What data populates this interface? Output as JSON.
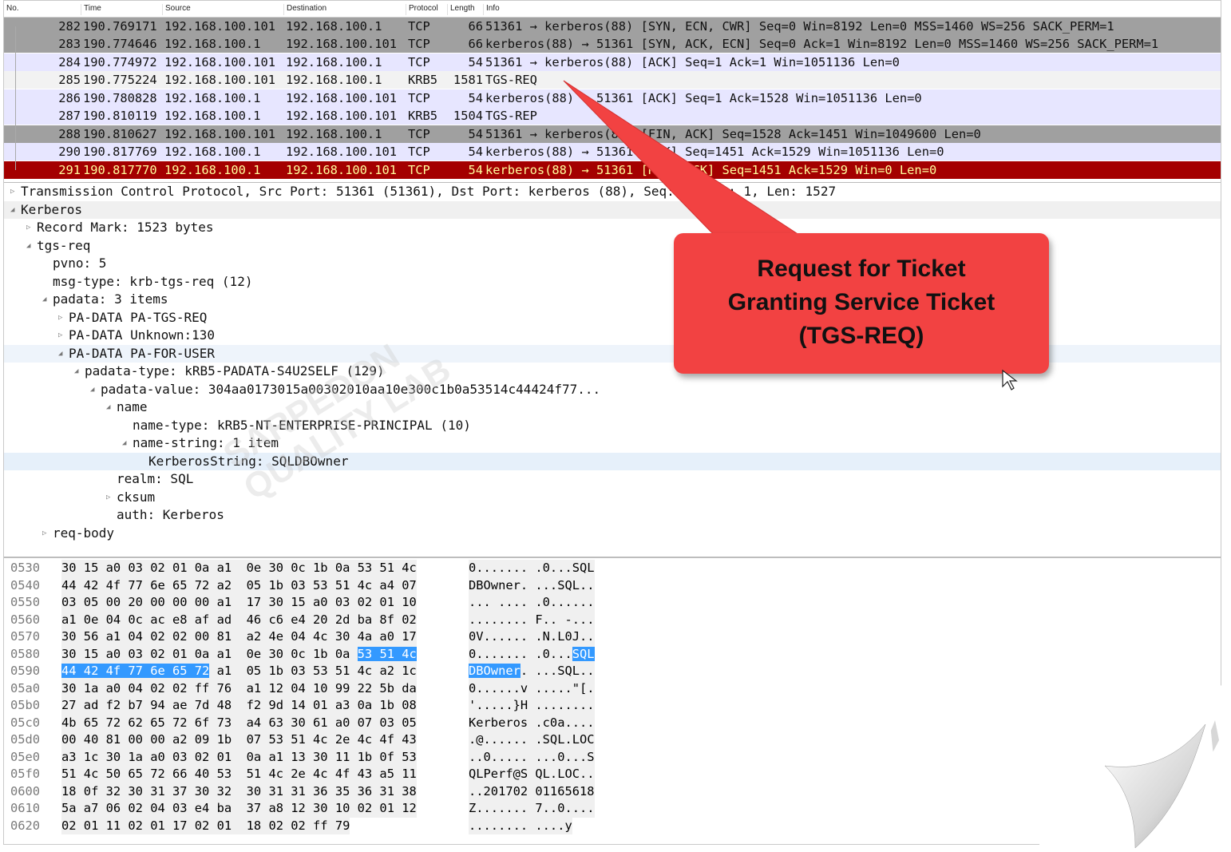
{
  "columns": {
    "no": "No.",
    "time": "Time",
    "source": "Source",
    "destination": "Destination",
    "protocol": "Protocol",
    "length": "Length",
    "info": "Info"
  },
  "packets": [
    {
      "no": "282",
      "time": "190.769171",
      "src": "192.168.100.101",
      "dst": "192.168.100.1",
      "proto": "TCP",
      "len": "66",
      "info": "51361 → kerberos(88) [SYN, ECN, CWR] Seq=0 Win=8192 Len=0 MSS=1460 WS=256 SACK_PERM=1",
      "bg": "#a0a0a0",
      "fg": "#111111"
    },
    {
      "no": "283",
      "time": "190.774646",
      "src": "192.168.100.1",
      "dst": "192.168.100.101",
      "proto": "TCP",
      "len": "66",
      "info": "kerberos(88) → 51361 [SYN, ACK, ECN] Seq=0 Ack=1 Win=8192 Len=0 MSS=1460 WS=256 SACK_PERM=1",
      "bg": "#a0a0a0",
      "fg": "#111111"
    },
    {
      "no": "284",
      "time": "190.774972",
      "src": "192.168.100.101",
      "dst": "192.168.100.1",
      "proto": "TCP",
      "len": "54",
      "info": "51361 → kerberos(88) [ACK] Seq=1 Ack=1 Win=1051136 Len=0",
      "bg": "#e7e6ff",
      "fg": "#111111"
    },
    {
      "no": "285",
      "time": "190.775224",
      "src": "192.168.100.101",
      "dst": "192.168.100.1",
      "proto": "KRB5",
      "len": "1581",
      "info": "TGS-REQ",
      "bg": "#f2f2f2",
      "fg": "#111111"
    },
    {
      "no": "286",
      "time": "190.780828",
      "src": "192.168.100.1",
      "dst": "192.168.100.101",
      "proto": "TCP",
      "len": "54",
      "info": "kerberos(88) → 51361 [ACK] Seq=1 Ack=1528 Win=1051136 Len=0",
      "bg": "#e7e6ff",
      "fg": "#111111"
    },
    {
      "no": "287",
      "time": "190.810119",
      "src": "192.168.100.1",
      "dst": "192.168.100.101",
      "proto": "KRB5",
      "len": "1504",
      "info": "TGS-REP",
      "bg": "#e7e6ff",
      "fg": "#111111"
    },
    {
      "no": "288",
      "time": "190.810627",
      "src": "192.168.100.101",
      "dst": "192.168.100.1",
      "proto": "TCP",
      "len": "54",
      "info": "51361 → kerberos(88) [FIN, ACK] Seq=1528 Ack=1451 Win=1049600 Len=0",
      "bg": "#a0a0a0",
      "fg": "#111111"
    },
    {
      "no": "290",
      "time": "190.817769",
      "src": "192.168.100.1",
      "dst": "192.168.100.101",
      "proto": "TCP",
      "len": "54",
      "info": "kerberos(88) → 51361 [ACK] Seq=1451 Ack=1529 Win=1051136 Len=0",
      "bg": "#e7e6ff",
      "fg": "#111111"
    },
    {
      "no": "291",
      "time": "190.817770",
      "src": "192.168.100.1",
      "dst": "192.168.100.101",
      "proto": "TCP",
      "len": "54",
      "info": "kerberos(88) → 51361 [RST, ACK] Seq=1451 Ack=1529 Win=0 Len=0",
      "bg": "#a40000",
      "fg": "#fffc9c"
    }
  ],
  "details": [
    {
      "t": "▷",
      "label": "Transmission Control Protocol, Src Port: 51361 (51361), Dst Port: kerberos (88), Seq: 1, Ack: 1, Len: 1527",
      "bg": "#ffffff"
    },
    {
      "t": "◢",
      "label": "Kerberos",
      "bg": "#f0f0f0"
    },
    {
      "t": "▷",
      "label": "Record Mark: 1523 bytes",
      "bg": "#ffffff"
    },
    {
      "t": "◢",
      "label": "tgs-req",
      "bg": "#ffffff"
    },
    {
      "t": "",
      "label": "pvno: 5",
      "bg": "#ffffff"
    },
    {
      "t": "",
      "label": "msg-type: krb-tgs-req (12)",
      "bg": "#ffffff"
    },
    {
      "t": "◢",
      "label": "padata: 3 items",
      "bg": "#ffffff"
    },
    {
      "t": "▷",
      "label": "PA-DATA PA-TGS-REQ",
      "bg": "#ffffff"
    },
    {
      "t": "▷",
      "label": "PA-DATA Unknown:130",
      "bg": "#ffffff"
    },
    {
      "t": "◢",
      "label": "PA-DATA PA-FOR-USER",
      "bg": "#eef4fb"
    },
    {
      "t": "◢",
      "label": "padata-type: kRB5-PADATA-S4U2SELF (129)",
      "bg": "#ffffff"
    },
    {
      "t": "◢",
      "label": "padata-value: 304aa0173015a00302010aa10e300c1b0a53514c44424f77...",
      "bg": "#ffffff"
    },
    {
      "t": "◢",
      "label": "name",
      "bg": "#ffffff"
    },
    {
      "t": "",
      "label": "name-type: kRB5-NT-ENTERPRISE-PRINCIPAL (10)",
      "bg": "#ffffff"
    },
    {
      "t": "◢",
      "label": "name-string: 1 item",
      "bg": "#ffffff"
    },
    {
      "t": "",
      "label": "KerberosString: SQLDBOwner",
      "bg": "#e6f0fa"
    },
    {
      "t": "",
      "label": "realm: SQL",
      "bg": "#ffffff"
    },
    {
      "t": "▷",
      "label": "cksum",
      "bg": "#ffffff"
    },
    {
      "t": "",
      "label": "auth: Kerberos",
      "bg": "#ffffff"
    },
    {
      "t": "▷",
      "label": "req-body",
      "bg": "#ffffff"
    }
  ],
  "bytes": [
    {
      "off": "0530",
      "hex": "30 15 a0 03 02 01 0a a1  0e 30 0c 1b 0a 53 51 4c",
      "asc": "0....... .0...SQL"
    },
    {
      "off": "0540",
      "hex": "44 42 4f 77 6e 65 72 a2  05 1b 03 53 51 4c a4 07",
      "asc": "DBOwner. ...SQL.."
    },
    {
      "off": "0550",
      "hex": "03 05 00 20 00 00 00 a1  17 30 15 a0 03 02 01 10",
      "asc": "... .... .0......"
    },
    {
      "off": "0560",
      "hex": "a1 0e 04 0c ac e8 af ad  46 c6 e4 20 2d ba 8f 02",
      "asc": "........ F.. -..."
    },
    {
      "off": "0570",
      "hex": "30 56 a1 04 02 02 00 81  a2 4e 04 4c 30 4a a0 17",
      "asc": "0V...... .N.L0J.."
    },
    {
      "off": "0580",
      "hex": "30 15 a0 03 02 01 0a a1  0e 30 0c 1b 0a ",
      "hexhl": "53 51 4c",
      "asc": "0....... .0...",
      "aschl": "SQL"
    },
    {
      "off": "0590",
      "hexhlpre": "44 42 4f 77 6e 65 72",
      "hex": " a1  05 1b 03 53 51 4c a2 1c",
      "aschlpre": "DBOwner",
      "asc": ". ...SQL.."
    },
    {
      "off": "05a0",
      "hex": "30 1a a0 04 02 02 ff 76  a1 12 04 10 99 22 5b da",
      "asc": "0......v .....\"[."
    },
    {
      "off": "05b0",
      "hex": "27 ad f2 b7 94 ae 7d 48  f2 9d 14 01 a3 0a 1b 08",
      "asc": "'.....}H ........"
    },
    {
      "off": "05c0",
      "hex": "4b 65 72 62 65 72 6f 73  a4 63 30 61 a0 07 03 05",
      "asc": "Kerberos .c0a...."
    },
    {
      "off": "05d0",
      "hex": "00 40 81 00 00 a2 09 1b  07 53 51 4c 2e 4c 4f 43",
      "asc": ".@...... .SQL.LOC"
    },
    {
      "off": "05e0",
      "hex": "a3 1c 30 1a a0 03 02 01  0a a1 13 30 11 1b 0f 53",
      "asc": "..0..... ...0...S"
    },
    {
      "off": "05f0",
      "hex": "51 4c 50 65 72 66 40 53  51 4c 2e 4c 4f 43 a5 11",
      "asc": "QLPerf@S QL.LOC.."
    },
    {
      "off": "0600",
      "hex": "18 0f 32 30 31 37 30 32  30 31 31 36 35 36 31 38",
      "asc": "..201702 01165618"
    },
    {
      "off": "0610",
      "hex": "5a a7 06 02 04 03 e4 ba  37 a8 12 30 10 02 01 12",
      "asc": "Z....... 7..0...."
    },
    {
      "off": "0620",
      "hex": "02 01 11 02 01 17 02 01  18 02 02 ff 79",
      "asc": "........ ....y"
    }
  ],
  "callout": {
    "line1": "Request for Ticket",
    "line2": "Granting Service Ticket",
    "line3": "(TGS-REQ)",
    "color": "#f24242"
  },
  "watermark": {
    "line1": "SARPEDON",
    "line2": "QUALITY LAB"
  }
}
